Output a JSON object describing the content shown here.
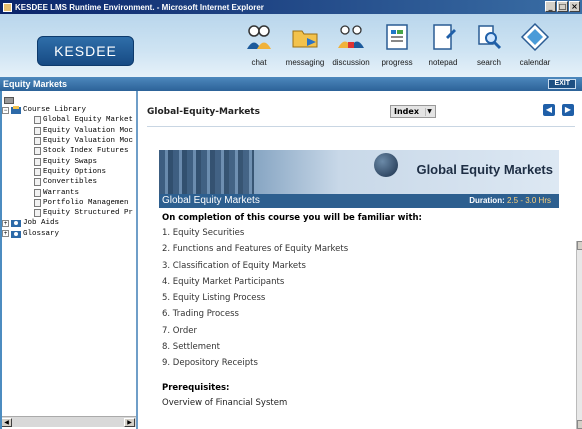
{
  "window": {
    "title": "KESDEE LMS Runtime Environment. - Microsoft Internet Explorer",
    "min_label": "_",
    "max_label": "□",
    "close_label": "×"
  },
  "header": {
    "logo_text": "KESDEE",
    "tools": [
      {
        "label": "chat",
        "icon": "chat-icon"
      },
      {
        "label": "messaging",
        "icon": "messaging-icon"
      },
      {
        "label": "discussion",
        "icon": "discussion-icon"
      },
      {
        "label": "progress",
        "icon": "progress-icon"
      },
      {
        "label": "notepad",
        "icon": "notepad-icon"
      },
      {
        "label": "search",
        "icon": "search-icon"
      },
      {
        "label": "calendar",
        "icon": "calendar-icon"
      }
    ]
  },
  "section": {
    "title": "Equity Markets",
    "exit_label": "EXIT"
  },
  "tree": {
    "root_label": "Course Library",
    "children": [
      "Global Equity Market",
      "Equity Valuation Moc",
      "Equity Valuation Moc",
      "Stock Index Futures",
      "Equity Swaps",
      "Equity Options",
      "Convertibles",
      "Warrants",
      "Portfolio Managemen",
      "Equity Structured Pr"
    ],
    "job_aids_label": "Job Aids",
    "glossary_label": "Glossary"
  },
  "main": {
    "page_title": "Global-Equity-Markets",
    "index_label": "Index",
    "banner_title": "Global Equity Markets",
    "bar_title": "Global Equity Markets",
    "duration_label": "Duration:",
    "duration_value": "2.5 - 3.0 Hrs",
    "intro": "On completion of this course you will be familiar with:",
    "topics": [
      "1. Equity Securities",
      "2. Functions and Features of Equity Markets",
      "3. Classification of Equity Markets",
      "4. Equity Market Participants",
      "5. Equity Listing Process",
      "6. Trading Process",
      "7. Order",
      "8. Settlement",
      "9. Depository Receipts"
    ],
    "prereq_heading": "Prerequisites:",
    "prereq_value": "Overview of Financial System"
  },
  "colors": {
    "section_bar": "#2c6298",
    "banner_bar": "#2d5f8f",
    "duration_accent": "#ffd27a",
    "nav_button": "#1f5fa8"
  }
}
